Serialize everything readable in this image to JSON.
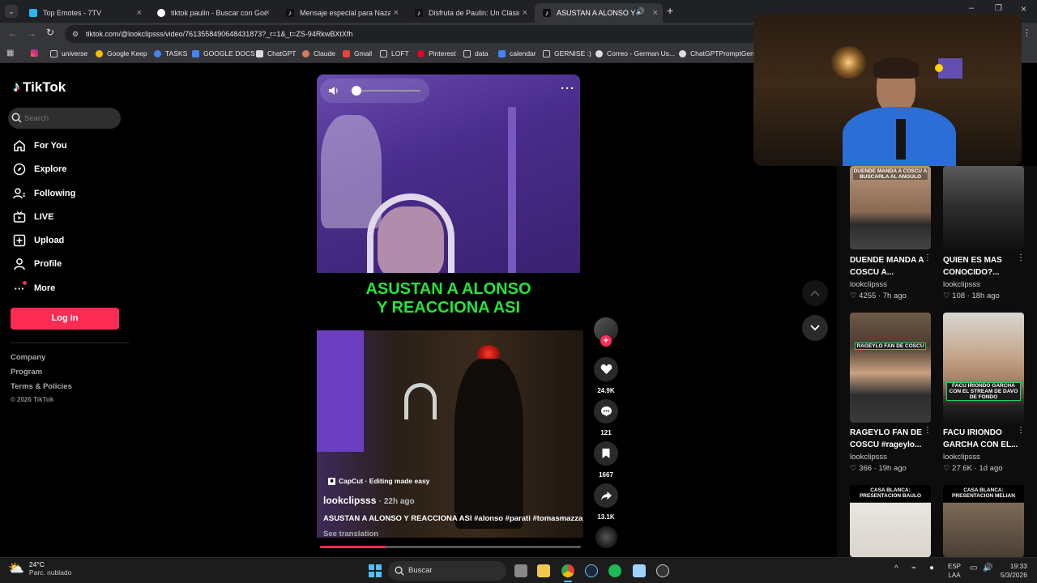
{
  "browser": {
    "tabs": [
      {
        "label": "Top Emotes - 7TV",
        "color": "#29b6f6"
      },
      {
        "label": "tiktok paulin - Buscar con Google",
        "color": "#4285f4"
      },
      {
        "label": "Mensaje especial para Nazarena",
        "color": "#111111"
      },
      {
        "label": "Disfruta de Paulin: Un Clásico d",
        "color": "#111111"
      },
      {
        "label": "ASUSTAN A ALONSO Y REA",
        "color": "#111111"
      }
    ],
    "url": "tiktok.com/@lookclipsss/video/7613558490648431873?_r=1&_t=ZS-94RkwBXtXfh",
    "bookmarks": [
      {
        "label": "universe",
        "color": "#888"
      },
      {
        "label": "Google Keep",
        "color": "#fbbc04"
      },
      {
        "label": "TASKS",
        "color": "#4285f4"
      },
      {
        "label": "GOOGLE DOCS",
        "color": "#4285f4"
      },
      {
        "label": "ChatGPT",
        "color": "#cccccc"
      },
      {
        "label": "Claude",
        "color": "#d97757"
      },
      {
        "label": "Gmail",
        "color": "#ea4335"
      },
      {
        "label": "LOFT",
        "color": "#888"
      },
      {
        "label": "Pinterest",
        "color": "#e60023"
      },
      {
        "label": "data",
        "color": "#888"
      },
      {
        "label": "calendar",
        "color": "#4285f4"
      },
      {
        "label": "GERNISE :)",
        "color": "#888"
      },
      {
        "label": "Correo - German Us...",
        "color": "#cccccc"
      },
      {
        "label": "ChatGPTPromptGen...",
        "color": "#cccccc"
      }
    ]
  },
  "sidebar": {
    "logo": "TikTok",
    "search_placeholder": "Search",
    "nav": [
      {
        "label": "For You",
        "icon": "home-icon"
      },
      {
        "label": "Explore",
        "icon": "compass-icon"
      },
      {
        "label": "Following",
        "icon": "following-icon"
      },
      {
        "label": "LIVE",
        "icon": "live-icon"
      },
      {
        "label": "Upload",
        "icon": "upload-icon"
      },
      {
        "label": "Profile",
        "icon": "profile-icon"
      },
      {
        "label": "More",
        "icon": "more-icon"
      }
    ],
    "login_label": "Log In",
    "footer": [
      "Company",
      "Program",
      "Terms & Policies"
    ],
    "copyright": "© 2026 TikTok"
  },
  "video": {
    "caption_overlay_line1": "ASUSTAN A ALONSO",
    "caption_overlay_line2": "Y REACCIONA ASI",
    "capcut_label": "CapCut · Editing made easy",
    "author": "lookclipsss",
    "time_ago": "· 22h ago",
    "description": "ASUSTAN A ALONSO Y REACCIONA ASI #alonso #parati #tomasmazza",
    "see_translation": "See translation",
    "likes": "24.9K",
    "comments": "121",
    "saves": "1667",
    "shares": "13.1K",
    "progress": 0.25,
    "accent": "#fe2c55"
  },
  "related": [
    {
      "thumb_text": "DUENDE MANDA A COSCU A BUSCARLA AL ANGULO",
      "title": "DUENDE MANDA A COSCU A...",
      "user": "lookclipsss",
      "likes": "4255",
      "ago": "7h ago"
    },
    {
      "thumb_text": "",
      "title": "QUIEN ES MAS CONOCIDO?...",
      "user": "lookclipsss",
      "likes": "108",
      "ago": "18h ago"
    },
    {
      "thumb_text": "RAGEYLO FAN DE COSCU",
      "title": "RAGEYLO FAN DE COSCU #rageylo...",
      "user": "lookclipsss",
      "likes": "366",
      "ago": "19h ago"
    },
    {
      "thumb_text": "FACU IRIONDO GARCHA CON EL STREAM DE DAVO DE FONDO",
      "title": "FACU IRIONDO GARCHA CON EL...",
      "user": "lookclipsss",
      "likes": "27.6K",
      "ago": "1d ago"
    },
    {
      "thumb_text": "CASA BLANCA: PRESENTACION BAULO",
      "title": "",
      "user": "",
      "likes": "",
      "ago": ""
    },
    {
      "thumb_text": "CASA BLANCA: PRESENTACION MELIAN",
      "title": "",
      "user": "",
      "likes": "",
      "ago": ""
    }
  ],
  "taskbar": {
    "temp": "24°C",
    "weather": "Parc. nublado",
    "search": "Buscar",
    "lang1": "ESP",
    "lang2": "LAA",
    "time": "19:33",
    "date": "5/3/2026"
  }
}
